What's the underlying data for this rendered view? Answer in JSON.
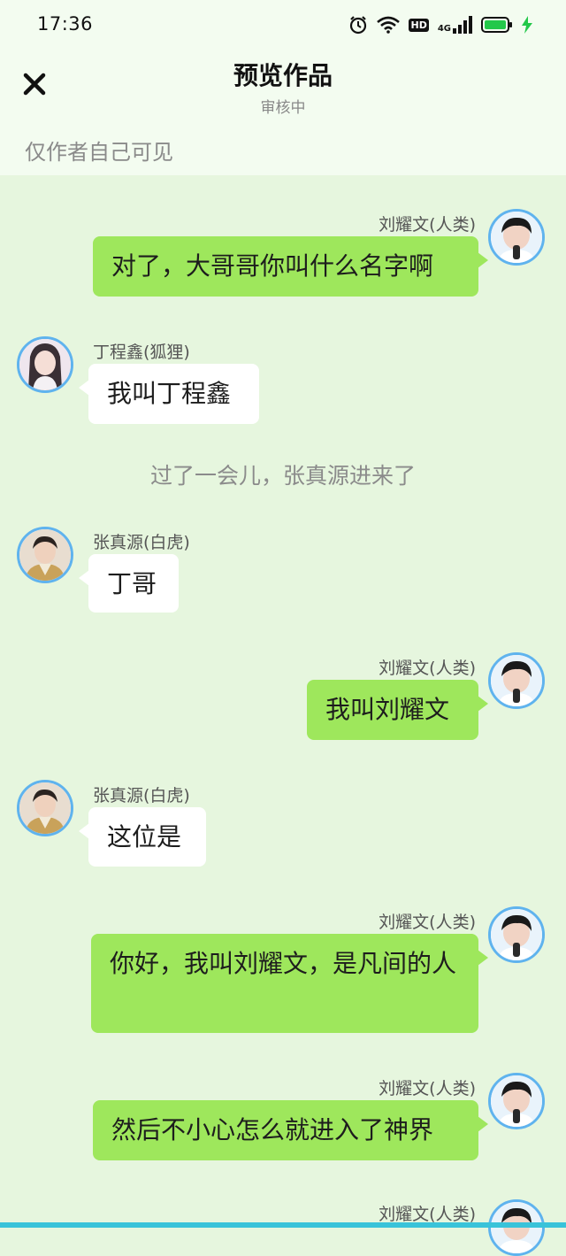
{
  "status_bar": {
    "time": "17:36",
    "hd_label": "HD",
    "network_label": "4G",
    "icons": [
      "alarm-icon",
      "wifi-icon",
      "hd-icon",
      "signal-icon",
      "battery-icon",
      "charging-icon"
    ],
    "battery_color": "#23c84a"
  },
  "header": {
    "title": "预览作品",
    "subtitle": "审核中",
    "close_icon": "close-icon"
  },
  "visibility_note": "仅作者自己可见",
  "colors": {
    "background": "#e6f6de",
    "my_bubble": "#9ee75c",
    "other_bubble": "#ffffff",
    "avatar_ring": "#5fb3ee"
  },
  "messages": [
    {
      "sender": "刘耀文(人类)",
      "text": "对了，大哥哥你叫什么名字啊",
      "side": "right"
    },
    {
      "sender": "丁程鑫(狐狸)",
      "text": "我叫丁程鑫",
      "side": "left"
    },
    {
      "narration": "过了一会儿，张真源进来了"
    },
    {
      "sender": "张真源(白虎)",
      "text": "丁哥",
      "side": "left"
    },
    {
      "sender": "刘耀文(人类)",
      "text": "我叫刘耀文",
      "side": "right"
    },
    {
      "sender": "张真源(白虎)",
      "text": "这位是",
      "side": "left"
    },
    {
      "sender": "刘耀文(人类)",
      "text": "你好，我叫刘耀文，是凡间的人",
      "side": "right"
    },
    {
      "sender": "刘耀文(人类)",
      "text": "然后不小心怎么就进入了神界",
      "side": "right"
    },
    {
      "sender": "刘耀文(人类)",
      "side": "right"
    }
  ]
}
